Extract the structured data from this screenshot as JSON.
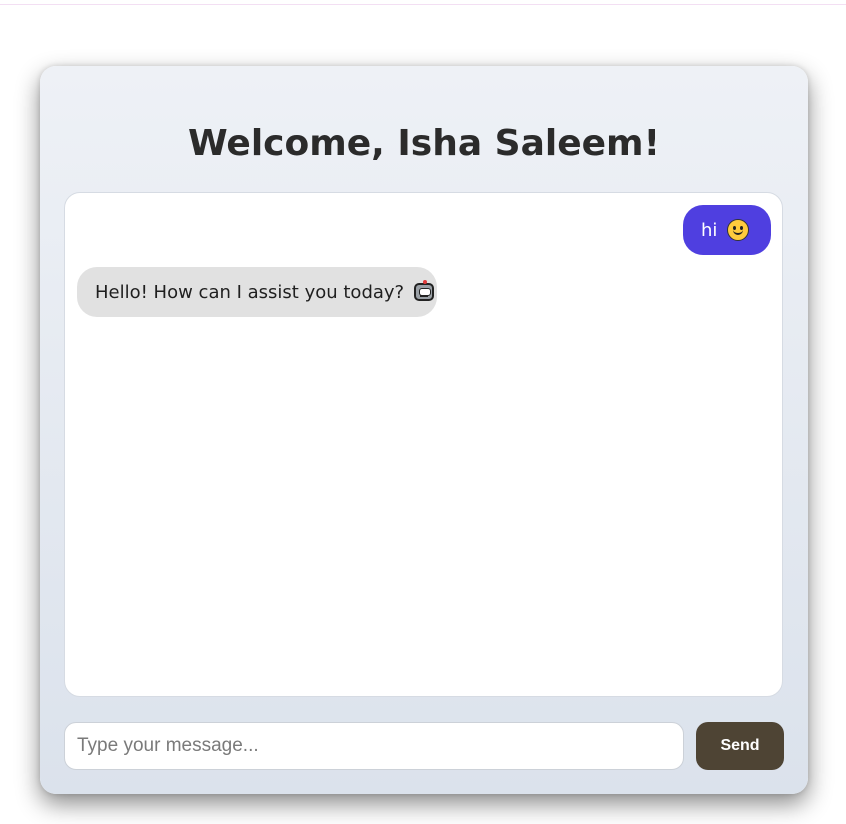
{
  "header": {
    "title": "Welcome, Isha Saleem!"
  },
  "chat": {
    "messages": [
      {
        "sender": "user",
        "text": "hi",
        "emoji": "smiling-face-icon"
      },
      {
        "sender": "bot",
        "text": "Hello! How can I assist you today?",
        "emoji": "robot-face-icon"
      }
    ]
  },
  "composer": {
    "placeholder": "Type your message...",
    "value": "",
    "send_label": "Send"
  },
  "colors": {
    "user_bubble": "#4f3fe0",
    "bot_bubble": "#e1e1e1",
    "send_button": "#4e4434",
    "title_text": "#2b2b2b"
  }
}
